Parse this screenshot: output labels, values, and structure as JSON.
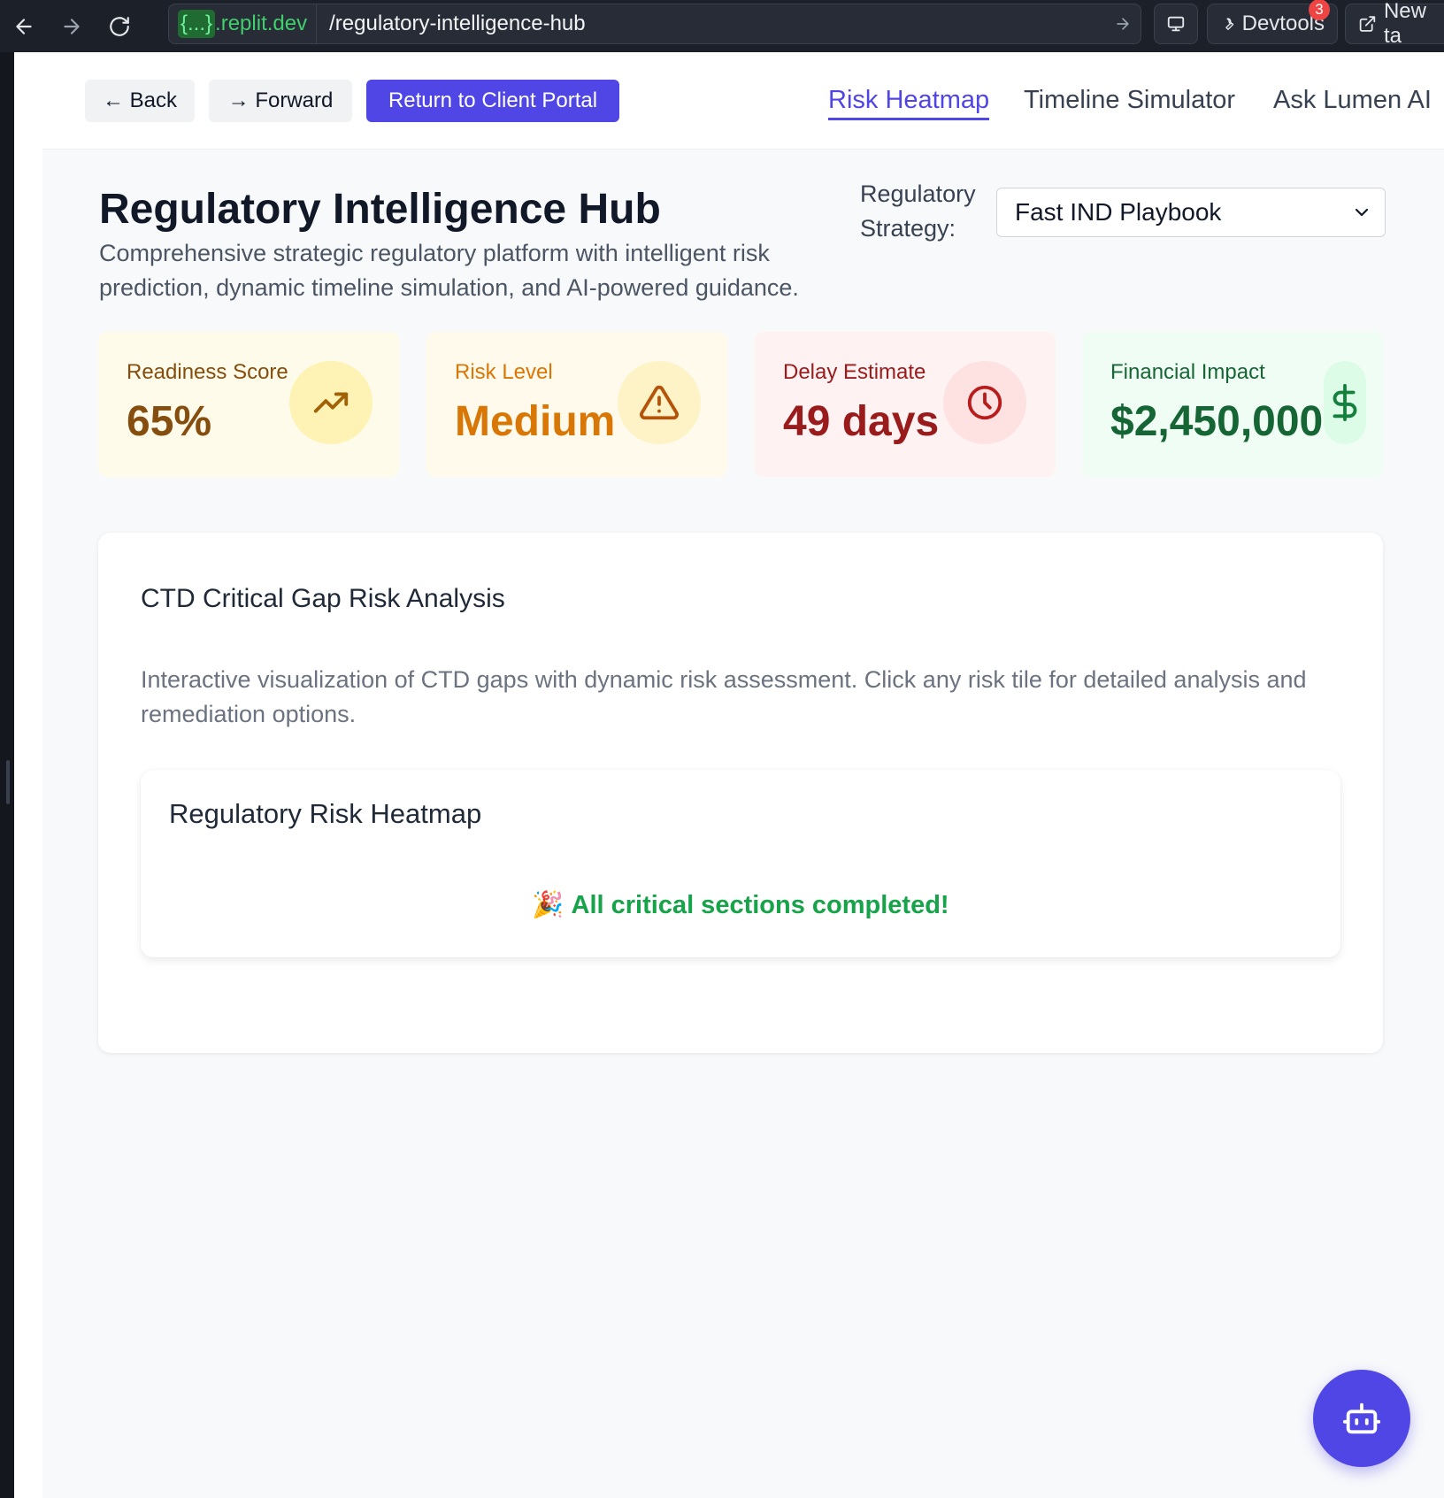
{
  "browser": {
    "host_brace": "{...}",
    "host_domain": ".replit.dev",
    "path": "/regulatory-intelligence-hub",
    "devtools_label": "Devtools",
    "devtools_badge": "3",
    "newtab_label": "New ta"
  },
  "nav": {
    "back_label": "← Back",
    "forward_label": "→ Forward",
    "portal_label": "Return to Client Portal",
    "tabs": [
      {
        "label": "Risk Heatmap",
        "active": true
      },
      {
        "label": "Timeline Simulator",
        "active": false
      },
      {
        "label": "Ask Lumen AI",
        "active": false
      }
    ]
  },
  "header": {
    "title": "Regulatory Intelligence Hub",
    "subtitle": "Comprehensive strategic regulatory platform with intelligent risk prediction, dynamic timeline simulation, and AI-powered guidance.",
    "strategy_label": "Regulatory Strategy:",
    "strategy_value": "Fast IND Playbook"
  },
  "metrics": [
    {
      "label": "Readiness Score",
      "value": "65%",
      "icon": "trending-up-icon",
      "bg": "#fefbea",
      "label_color": "#854d0e",
      "value_color": "#854d0e",
      "icon_bg": "#fef3b4",
      "icon_color": "#a16207"
    },
    {
      "label": "Risk Level",
      "value": "Medium",
      "icon": "alert-triangle-icon",
      "bg": "#fffaeb",
      "label_color": "#d97706",
      "value_color": "#d97706",
      "icon_bg": "#fef3c7",
      "icon_color": "#b45309"
    },
    {
      "label": "Delay Estimate",
      "value": "49 days",
      "icon": "clock-icon",
      "bg": "#fef2f2",
      "label_color": "#991b1b",
      "value_color": "#991b1b",
      "icon_bg": "#fee2e2",
      "icon_color": "#b91c1c"
    },
    {
      "label": "Financial Impact",
      "value": "$2,450,000",
      "icon": "dollar-icon",
      "bg": "#f0fdf4",
      "label_color": "#166534",
      "value_color": "#166534",
      "icon_bg": "#dcfce7",
      "icon_color": "#15803d"
    }
  ],
  "analysis": {
    "title": "CTD Critical Gap Risk Analysis",
    "description": "Interactive visualization of CTD gaps with dynamic risk assessment. Click any risk tile for detailed analysis and remediation options.",
    "heatmap_title": "Regulatory Risk Heatmap",
    "completion_emoji": "🎉",
    "completion_message": "All critical sections completed!"
  },
  "colors": {
    "accent": "#4f46e5",
    "success": "#16a34a"
  }
}
